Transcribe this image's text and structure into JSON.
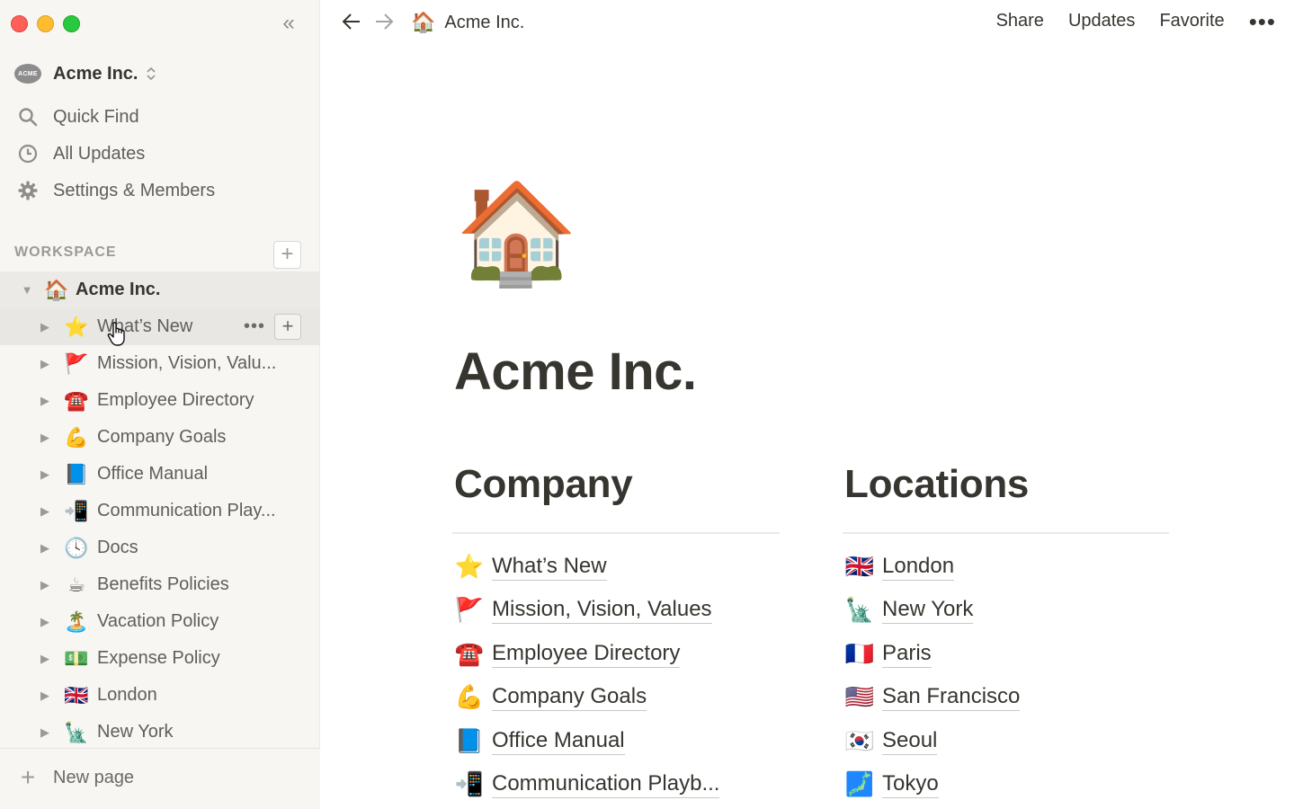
{
  "sidebar": {
    "workspace_name": "Acme Inc.",
    "workspace_logo_text": "ACME",
    "nav": [
      {
        "label": "Quick Find",
        "icon": "search-icon"
      },
      {
        "label": "All Updates",
        "icon": "clock-icon"
      },
      {
        "label": "Settings & Members",
        "icon": "gear-icon"
      }
    ],
    "section_header": "WORKSPACE",
    "tree": [
      {
        "emoji": "🏠",
        "label": "Acme Inc.",
        "expanded": true
      },
      {
        "emoji": "⭐",
        "label": "What’s New"
      },
      {
        "emoji": "🚩",
        "label": "Mission, Vision, Valu..."
      },
      {
        "emoji": "☎️",
        "label": "Employee Directory"
      },
      {
        "emoji": "💪",
        "label": "Company Goals"
      },
      {
        "emoji": "📘",
        "label": "Office Manual"
      },
      {
        "emoji": "📲",
        "label": "Communication Play..."
      },
      {
        "emoji": "🕓",
        "label": "Docs"
      },
      {
        "emoji": "☕",
        "label": "Benefits Policies"
      },
      {
        "emoji": "🏝️",
        "label": "Vacation Policy"
      },
      {
        "emoji": "💵",
        "label": "Expense Policy"
      },
      {
        "emoji": "🇬🇧",
        "label": "London"
      },
      {
        "emoji": "🗽",
        "label": "New York"
      }
    ],
    "new_page_label": "New page"
  },
  "topbar": {
    "breadcrumb_emoji": "🏠",
    "breadcrumb_label": "Acme Inc.",
    "share_label": "Share",
    "updates_label": "Updates",
    "favorite_label": "Favorite",
    "more_label": "•••"
  },
  "page": {
    "icon": "🏠",
    "title": "Acme Inc.",
    "company": {
      "heading": "Company",
      "links": [
        {
          "emoji": "⭐",
          "label": "What’s New"
        },
        {
          "emoji": "🚩",
          "label": "Mission, Vision, Values"
        },
        {
          "emoji": "☎️",
          "label": "Employee Directory"
        },
        {
          "emoji": "💪",
          "label": "Company Goals"
        },
        {
          "emoji": "📘",
          "label": "Office Manual"
        },
        {
          "emoji": "📲",
          "label": "Communication Playb..."
        }
      ]
    },
    "locations": {
      "heading": "Locations",
      "links": [
        {
          "emoji": "🇬🇧",
          "label": "London"
        },
        {
          "emoji": "🗽",
          "label": "New York"
        },
        {
          "emoji": "🇫🇷",
          "label": "Paris"
        },
        {
          "emoji": "🇺🇸",
          "label": "San Francisco"
        },
        {
          "emoji": "🇰🇷",
          "label": "Seoul"
        },
        {
          "emoji": "🗾",
          "label": "Tokyo"
        }
      ]
    }
  },
  "colors": {
    "sidebar_bg": "#f7f6f3",
    "text": "#37352f",
    "muted": "#9b9a97",
    "hover_row": "#e8e7e4"
  }
}
